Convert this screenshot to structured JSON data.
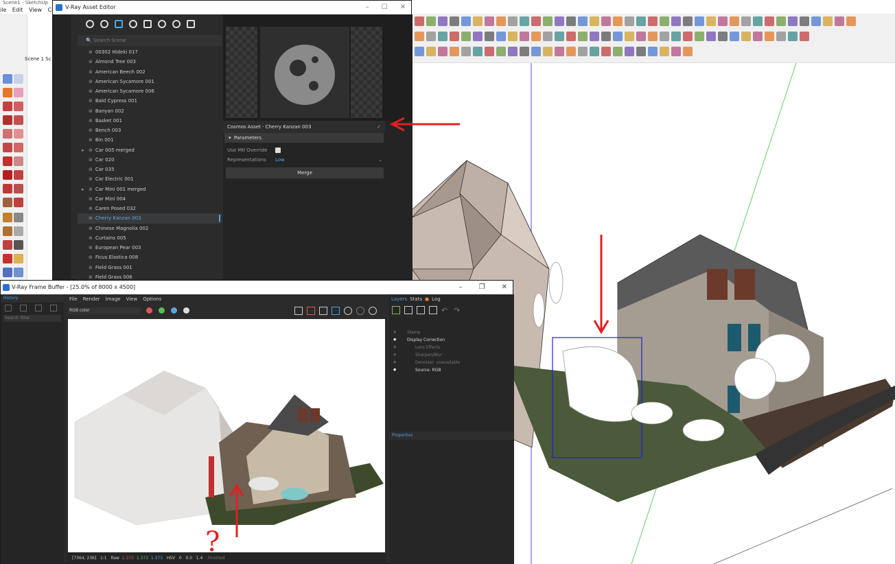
{
  "sketchup": {
    "title": "Scene1 - SketchUp",
    "menus": [
      "ile",
      "Edit",
      "View",
      "Camera"
    ],
    "scene_tabs": [
      "Scene 1",
      "Sc"
    ]
  },
  "asset_editor": {
    "title": "V-Ray Asset Editor",
    "search_placeholder": "Search Scene",
    "items": [
      {
        "label": "00302 Hideki 017",
        "sel": false,
        "expand": false
      },
      {
        "label": "Almond Tree 003",
        "sel": false,
        "expand": false
      },
      {
        "label": "American Beech 002",
        "sel": false,
        "expand": false
      },
      {
        "label": "American Sycamore 001",
        "sel": false,
        "expand": false
      },
      {
        "label": "American Sycamore 006",
        "sel": false,
        "expand": false
      },
      {
        "label": "Bald Cypress 001",
        "sel": false,
        "expand": false
      },
      {
        "label": "Banyan 002",
        "sel": false,
        "expand": false
      },
      {
        "label": "Basket 001",
        "sel": false,
        "expand": false
      },
      {
        "label": "Bench 003",
        "sel": false,
        "expand": false
      },
      {
        "label": "Bin 001",
        "sel": false,
        "expand": false
      },
      {
        "label": "Car 005 merged",
        "sel": false,
        "expand": true
      },
      {
        "label": "Car 020",
        "sel": false,
        "expand": false
      },
      {
        "label": "Car 035",
        "sel": false,
        "expand": false
      },
      {
        "label": "Car Electric 001",
        "sel": false,
        "expand": false
      },
      {
        "label": "Car Mini 001 merged",
        "sel": false,
        "expand": true
      },
      {
        "label": "Car Mini 004",
        "sel": false,
        "expand": false
      },
      {
        "label": "Caren Posed 032",
        "sel": false,
        "expand": false
      },
      {
        "label": "Cherry Kanzan 003",
        "sel": true,
        "expand": false
      },
      {
        "label": "Chinese Magnolia 002",
        "sel": false,
        "expand": false
      },
      {
        "label": "Curtains 005",
        "sel": false,
        "expand": false
      },
      {
        "label": "European Pear 003",
        "sel": false,
        "expand": false
      },
      {
        "label": "Ficus Elastica 008",
        "sel": false,
        "expand": false
      },
      {
        "label": "Field Grass 001",
        "sel": false,
        "expand": false
      },
      {
        "label": "Field Grass 006",
        "sel": false,
        "expand": false
      }
    ],
    "asset_title": "Cosmos Asset · Cherry Kanzan 003",
    "parameters_label": "Parameters",
    "use_mtl_label": "Use Mtl Override",
    "representations_label": "Representations",
    "representations_value": "Low",
    "merge_label": "Merge"
  },
  "frame_buffer": {
    "title": "V-Ray Frame Buffer - [25.0% of 8000 x 4500]",
    "history_label": "History",
    "search_filter": "Search filter",
    "menus": [
      "File",
      "Render",
      "Image",
      "View",
      "Options"
    ],
    "channel": "RGB color",
    "layer_tabs": [
      "Layers",
      "Stats",
      "Log"
    ],
    "layers": [
      {
        "label": "Stamp",
        "indent": 1,
        "on": false
      },
      {
        "label": "Display Correction",
        "indent": 1,
        "on": true
      },
      {
        "label": "Lens Effects",
        "indent": 2,
        "on": false
      },
      {
        "label": "Sharpen/Blur",
        "indent": 2,
        "on": false
      },
      {
        "label": "Denoiser: unavailable",
        "indent": 2,
        "on": false
      },
      {
        "label": "Source: RGB",
        "indent": 2,
        "on": true
      }
    ],
    "properties_label": "Properties",
    "status": {
      "coords": "[7364, 236]",
      "zoom": "1:1",
      "raw": "Raw",
      "r": "1.373",
      "g": "1.373",
      "b": "1.373",
      "mode": "HSV",
      "h": "0",
      "s": "0.0",
      "v": "1.4",
      "state": "Finished"
    }
  },
  "annotations": {
    "question_mark": "?",
    "arrow_color": "#e02020"
  }
}
